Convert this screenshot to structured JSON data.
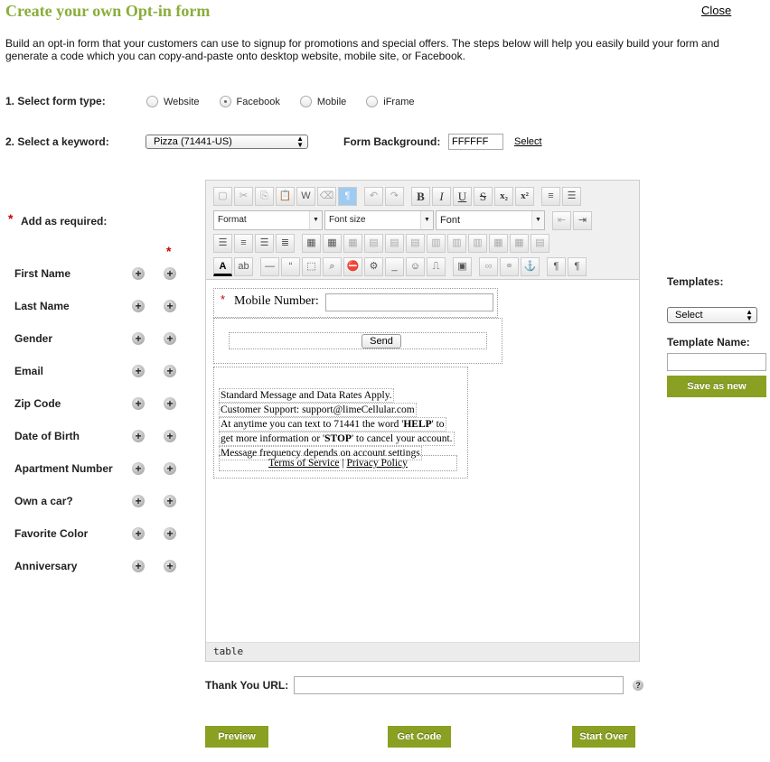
{
  "header": {
    "title": "Create your own Opt-in form",
    "close_label": "Close",
    "intro": "Build an opt-in form that your customers can use to signup for promotions and special offers. The steps below will help you easily build your form and generate a code which you can copy-and-paste onto desktop website, mobile site, or Facebook."
  },
  "step1": {
    "label": "1. Select form type:",
    "options": [
      "Website",
      "Facebook",
      "Mobile",
      "iFrame"
    ],
    "selected": "Facebook"
  },
  "step2": {
    "label": "2. Select a keyword:",
    "keyword_value": "Pizza (71441-US)",
    "background_label": "Form Background:",
    "background_value": "FFFFFF",
    "select_link": "Select"
  },
  "fields": {
    "required_star": "*",
    "add_as_required_label": "Add as required:",
    "column_star": "*",
    "items": [
      "First Name",
      "Last Name",
      "Gender",
      "Email",
      "Zip Code",
      "Date of Birth",
      "Apartment Number",
      "Own a car?",
      "Favorite Color",
      "Anniversary"
    ],
    "plus_glyph": "+"
  },
  "editor": {
    "toolbar": {
      "format_label": "Format",
      "fontsize_label": "Font size",
      "font_label": "Font",
      "bold": "B",
      "italic": "I",
      "underline": "U",
      "strike": "S",
      "subscript": "x₂",
      "superscript": "x²"
    },
    "form": {
      "mobile_star": "*",
      "mobile_label": "Mobile Number:",
      "send_label": "Send"
    },
    "legal": {
      "line1": "Standard Message and Data Rates Apply.",
      "line2": "Customer Support: support@limeCellular.com",
      "line3_a": "At anytime you can text to 71441 the word '",
      "line3_help": "HELP",
      "line3_b": "' to",
      "line4_a": "get more information or '",
      "line4_stop": "STOP",
      "line4_b": "' to cancel your account.",
      "line5": "Message frequency depends on account settings",
      "terms": "Terms of Service",
      "separator": "|",
      "privacy": "Privacy Policy"
    },
    "status_path": "table"
  },
  "templates": {
    "label": "Templates:",
    "select_value": "Select",
    "name_label": "Template Name:",
    "name_value": "",
    "save_label": "Save as new"
  },
  "thank_you": {
    "label": "Thank You URL:",
    "value": "",
    "help_glyph": "?"
  },
  "actions": {
    "preview": "Preview",
    "get_code": "Get Code",
    "start_over": "Start Over"
  },
  "colors": {
    "accent": "#8aad3a",
    "button": "#8aa022",
    "required": "#cc0000"
  }
}
